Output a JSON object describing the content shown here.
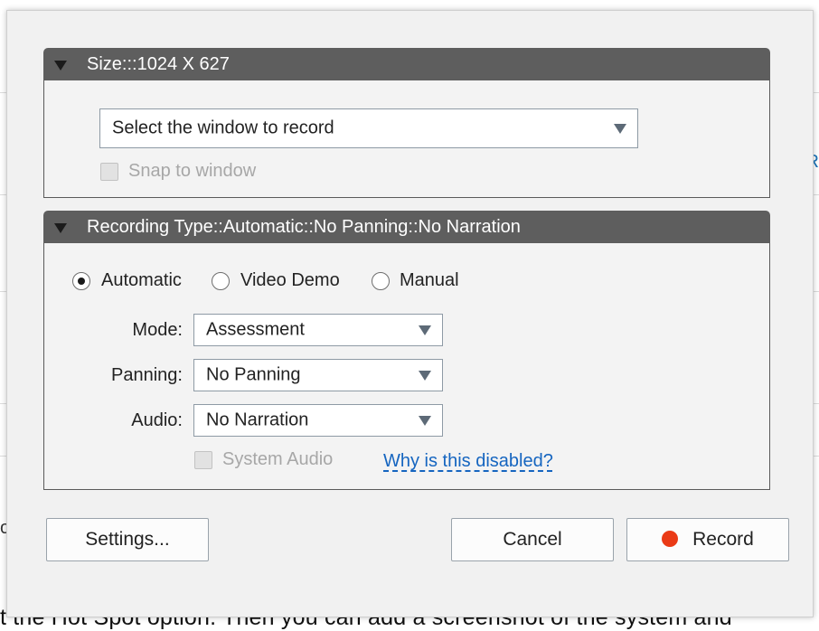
{
  "background": {
    "bottom_text": "t the Hot Spot option. Then you can add a screenshot of the system and",
    "left_glyph": "o",
    "right_glyph": "R"
  },
  "size_panel": {
    "title": "Size:::1024 X 627",
    "window_select": {
      "value": "Select the window to record"
    },
    "snap_to_window": {
      "label": "Snap to window",
      "checked": false,
      "disabled": true
    }
  },
  "recording_panel": {
    "title": "Recording Type::Automatic::No Panning::No Narration",
    "recording_types": [
      {
        "label": "Automatic",
        "selected": true
      },
      {
        "label": "Video Demo",
        "selected": false
      },
      {
        "label": "Manual",
        "selected": false
      }
    ],
    "mode": {
      "label": "Mode:",
      "value": "Assessment"
    },
    "panning": {
      "label": "Panning:",
      "value": "No Panning"
    },
    "audio": {
      "label": "Audio:",
      "value": "No Narration"
    },
    "system_audio": {
      "label": "System Audio",
      "checked": false,
      "disabled": true
    },
    "help_link": "Why is this disabled?"
  },
  "buttons": {
    "settings": "Settings...",
    "cancel": "Cancel",
    "record": "Record"
  },
  "colors": {
    "header_bg": "#5e5e5e",
    "record_dot": "#ea3a16",
    "link": "#1565c0"
  }
}
